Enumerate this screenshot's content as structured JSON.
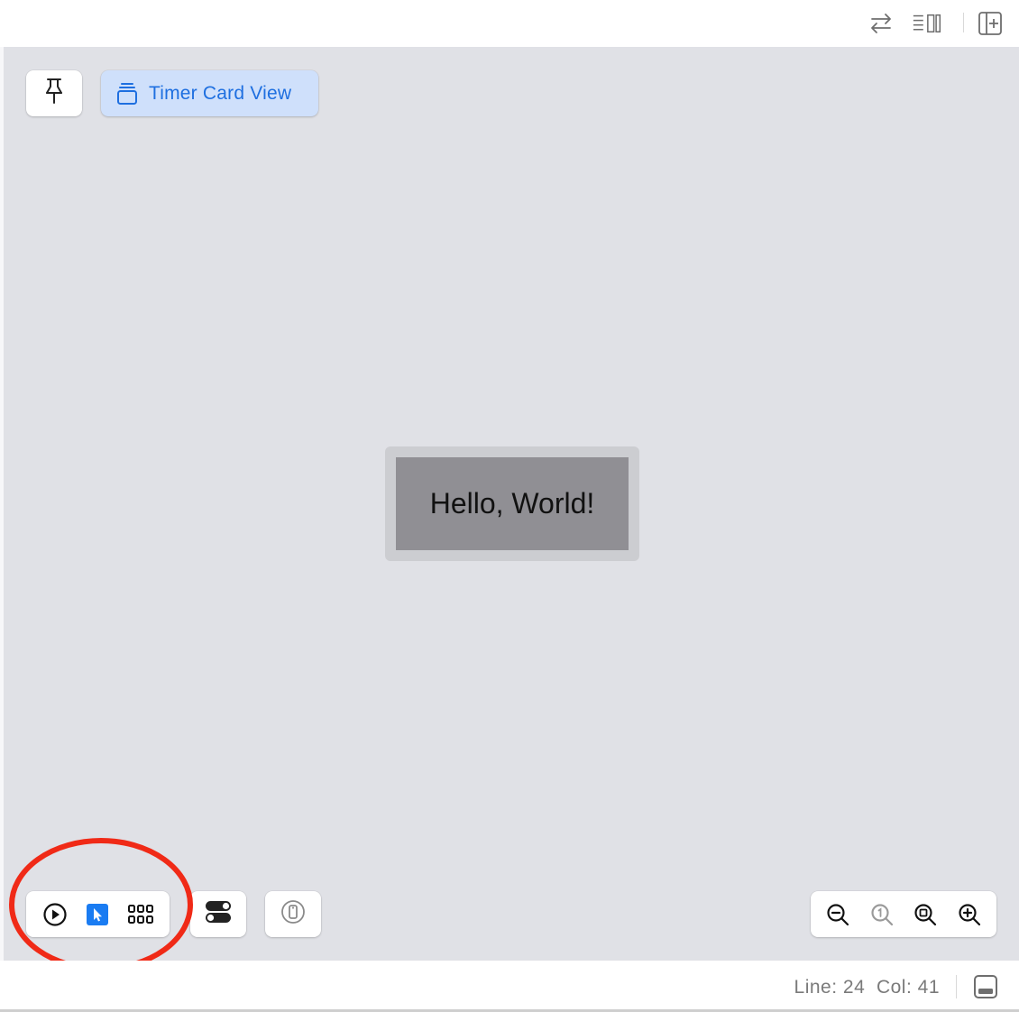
{
  "toolbar": {
    "icons": [
      "swap-arrows-icon",
      "inspector-layout-icon",
      "add-editor-icon"
    ]
  },
  "canvas": {
    "pin_icon": "pushpin-icon",
    "preview_title": "Timer Card View",
    "preview_title_icon": "stacked-cards-icon",
    "preview_text": "Hello, World!"
  },
  "bottom_controls": {
    "modes": [
      "live-play-icon",
      "selectable-cursor-icon",
      "variants-grid-icon"
    ],
    "selected_mode": "selectable-cursor-icon",
    "variants_icon": "toggle-switches-icon",
    "device_icon": "device-settings-icon",
    "zoom": [
      "zoom-out-icon",
      "zoom-100-icon",
      "zoom-to-fit-icon",
      "zoom-in-icon"
    ]
  },
  "status": {
    "line_label": "Line:",
    "line_value": "24",
    "col_label": "Col:",
    "col_value": "41"
  },
  "colors": {
    "accent": "#1a7cf2",
    "canvas_bg": "#e0e1e6",
    "annotation": "#f02a17"
  }
}
